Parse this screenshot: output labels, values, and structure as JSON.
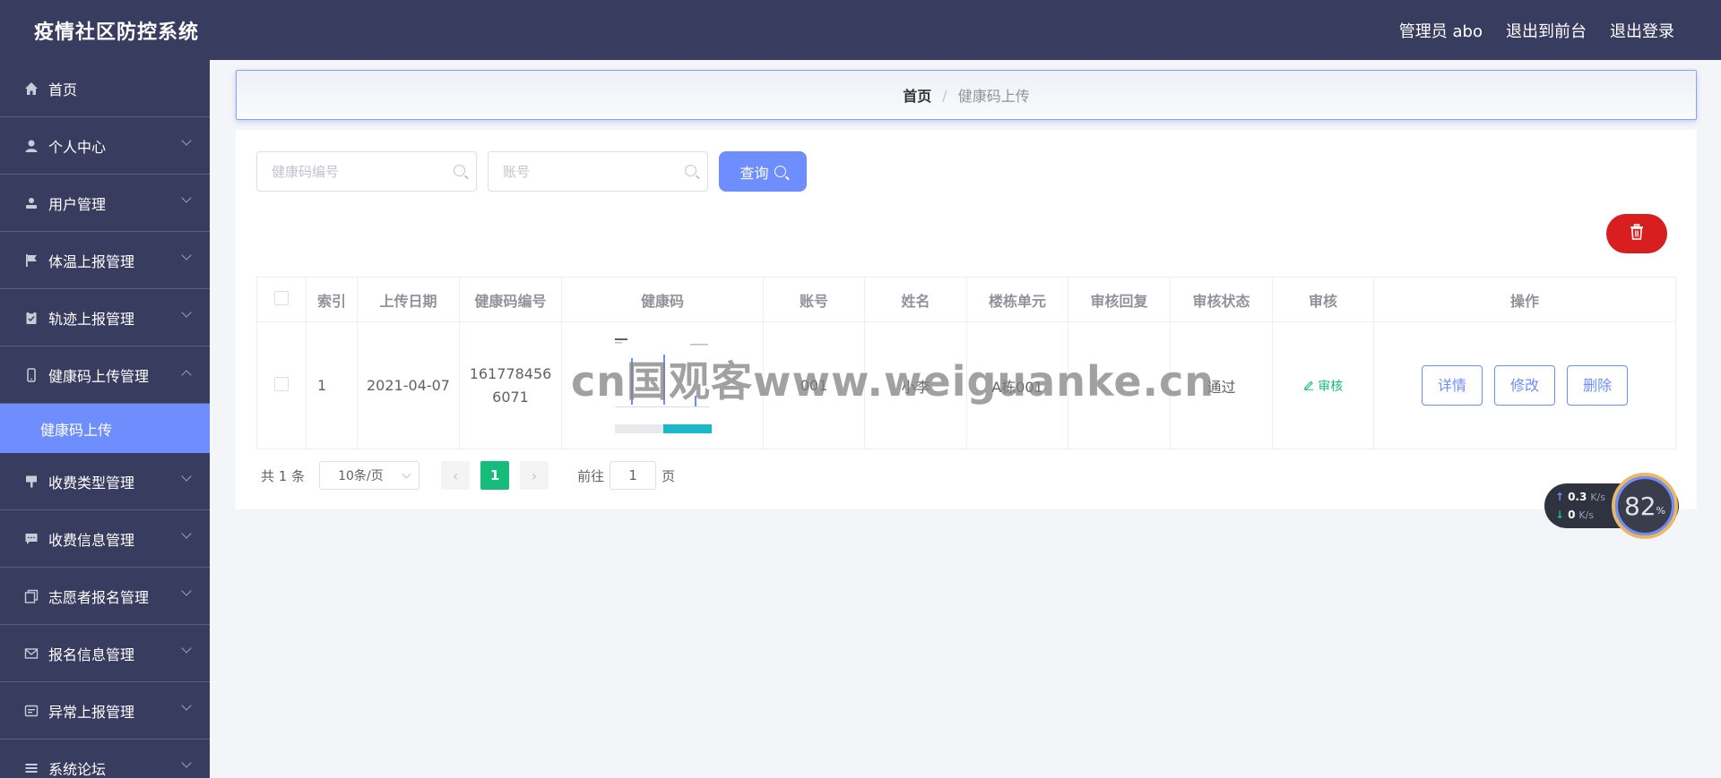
{
  "app": {
    "title": "疫情社区防控系统",
    "top_links": [
      "管理员 abo",
      "退出到前台",
      "退出登录"
    ]
  },
  "sidebar": {
    "items": [
      {
        "label": "首页",
        "icon": "home-icon",
        "has_arrow": false
      },
      {
        "label": "个人中心",
        "icon": "user-icon",
        "has_arrow": true
      },
      {
        "label": "用户管理",
        "icon": "user-admin-icon",
        "has_arrow": true
      },
      {
        "label": "体温上报管理",
        "icon": "flag-icon",
        "has_arrow": true
      },
      {
        "label": "轨迹上报管理",
        "icon": "clipboard-icon",
        "has_arrow": true
      },
      {
        "label": "健康码上传管理",
        "icon": "phone-icon",
        "has_arrow": true,
        "expanded": true
      },
      {
        "label": "收费类型管理",
        "icon": "brush-icon",
        "has_arrow": true
      },
      {
        "label": "收费信息管理",
        "icon": "message-icon",
        "has_arrow": true
      },
      {
        "label": "志愿者报名管理",
        "icon": "copy-icon",
        "has_arrow": true
      },
      {
        "label": "报名信息管理",
        "icon": "mail-icon",
        "has_arrow": true
      },
      {
        "label": "异常上报管理",
        "icon": "tickets-icon",
        "has_arrow": true
      },
      {
        "label": "系统论坛",
        "icon": "list-icon",
        "has_arrow": true
      }
    ],
    "active_subitem": "健康码上传"
  },
  "breadcrumb": {
    "home": "首页",
    "separator": "/",
    "current": "健康码上传"
  },
  "search": {
    "code_placeholder": "健康码编号",
    "account_placeholder": "账号",
    "query_label": "查询"
  },
  "table": {
    "columns": [
      "索引",
      "上传日期",
      "健康码编号",
      "健康码",
      "账号",
      "姓名",
      "楼栋单元",
      "审核回复",
      "审核状态",
      "审核",
      "操作"
    ],
    "rows": [
      {
        "index": "1",
        "upload_date": "2021-04-07",
        "code_line1": "161778456",
        "code_line2": "6071",
        "account": "001",
        "name": "小李",
        "building": "A栋001",
        "reply": "",
        "status": "通过",
        "audit_label": "审核",
        "actions": [
          "详情",
          "修改",
          "删除"
        ]
      }
    ]
  },
  "pagination": {
    "total_text": "共 1 条",
    "page_size": "10条/页",
    "current_page": "1",
    "goto_prefix": "前往",
    "goto_value": "1",
    "goto_suffix": "页"
  },
  "watermark": "cn国观客www.weiguanke.cn",
  "network": {
    "up": "0.3",
    "down": "0",
    "unit": "K/s",
    "percent": "82",
    "percent_sign": "%"
  },
  "colors": {
    "sidebar_bg": "#383c5e",
    "accent": "#6f8efd",
    "danger": "#d81e1e",
    "success": "#18bc7a"
  }
}
